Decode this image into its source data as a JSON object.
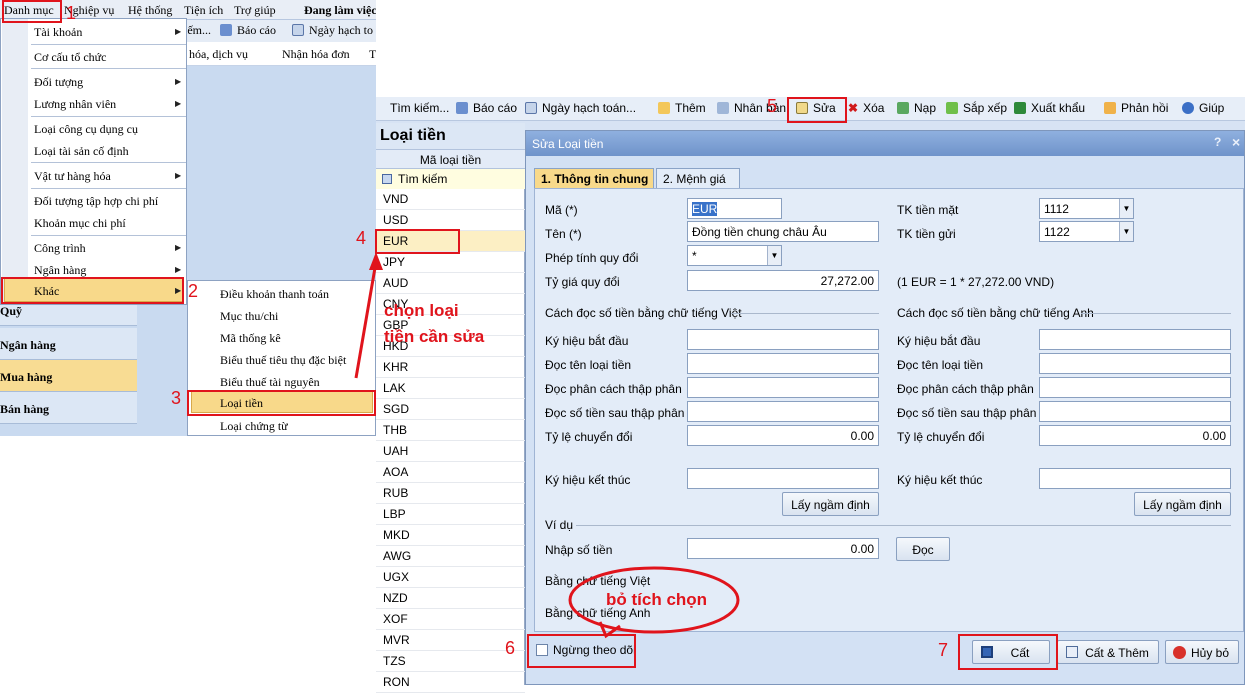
{
  "menubar": [
    "Danh mục",
    "Nghiệp vụ",
    "Hệ thống",
    "Tiện ích",
    "Trợ giúp",
    "Đang làm việc"
  ],
  "toolbar_left": {
    "item1": "iếm...",
    "item2": "Báo cáo",
    "item3": "Ngày hạch to"
  },
  "toolbar_left2": {
    "item1": "ng hóa, dịch vụ",
    "item2": "Nhận hóa đơn",
    "item3": "T"
  },
  "menu_items": [
    "Tài khoản",
    "Cơ cấu tổ chức",
    "Đối tượng",
    "Lương nhân viên",
    "Loại công cụ dụng cụ",
    "Loại tài sản cố định",
    "Vật tư hàng hóa",
    "Đối tượng tập hợp chi phí",
    "Khoản mục chi phí",
    "Công trình",
    "Ngân hàng",
    "Khác"
  ],
  "submenu_items": [
    "Điều khoản thanh toán",
    "Mục thu/chi",
    "Mã thống kê",
    "Biểu thuế tiêu thụ đặc biệt",
    "Biểu thuế tài nguyên",
    "Loại tiền",
    "Loại chứng từ"
  ],
  "nav_items": [
    "Quỹ",
    "Ngân hàng",
    "Mua hàng",
    "Bán hàng"
  ],
  "right_toolbar": [
    "Tìm kiếm...",
    "Báo cáo",
    "Ngày hạch toán...",
    "Thêm",
    "Nhân bản",
    "Sửa",
    "Xóa",
    "Nạp",
    "Sắp xếp",
    "Xuất khẩu",
    "Phản hồi",
    "Giúp"
  ],
  "list": {
    "title": "Loại tiền",
    "column": "Mã loại tiền",
    "search": "Tìm kiếm",
    "rows": [
      "VND",
      "USD",
      "EUR",
      "JPY",
      "AUD",
      "CNY",
      "GBP",
      "HKD",
      "KHR",
      "LAK",
      "SGD",
      "THB",
      "UAH",
      "AOA",
      "RUB",
      "LBP",
      "MKD",
      "AWG",
      "UGX",
      "NZD",
      "XOF",
      "MVR",
      "TZS",
      "RON"
    ]
  },
  "dialog": {
    "title": "Sửa Loại tiền",
    "help": "?",
    "close": "×",
    "tab1": "1. Thông tin chung",
    "tab2": "2. Mệnh giá",
    "ma_label": "Mã (*)",
    "ma_value": "EUR",
    "ten_label": "Tên (*)",
    "ten_value": "Đồng tiền chung châu Âu",
    "phep_label": "Phép tính quy đổi",
    "phep_value": "*",
    "tygia_label": "Tỷ giá quy đổi",
    "tygia_value": "27,272.00",
    "tk_mat_label": "TK tiền mặt",
    "tk_mat_value": "1112",
    "tk_gui_label": "TK tiền gửi",
    "tk_gui_value": "1122",
    "rate_note": "(1 EUR = 1 * 27,272.00  VND)",
    "vn_section": "Cách đọc số tiền bằng chữ tiếng Việt",
    "en_section": "Cách đọc số tiền bằng chữ tiếng Anh",
    "field_labels": [
      "Ký hiệu bắt đầu",
      "Đọc tên loại tiền",
      "Đọc phân cách thập phân",
      "Đọc số tiền sau thập phân",
      "Tỷ lệ chuyển đổi"
    ],
    "ratio_value": "0.00",
    "end_label": "Ký hiệu kết thúc",
    "default_btn": "Lấy ngầm định",
    "example": "Ví dụ",
    "input_label": "Nhập số tiền",
    "input_value": "0.00",
    "read_btn": "Đọc",
    "vn_words": "Bằng chữ tiếng Việt",
    "en_words": "Bằng chữ tiếng Anh",
    "stop_label": "Ngừng theo dõi",
    "save": "Cất",
    "save_add": "Cất & Thêm",
    "cancel": "Hủy bỏ"
  },
  "annotations": {
    "n1": "1",
    "n2": "2",
    "n3": "3",
    "n4": "4",
    "n5": "5",
    "n6": "6",
    "n7": "7",
    "choose1": "chọn loại",
    "choose2": "tiền cần sửa",
    "uncheck": "bỏ tích chọn"
  }
}
